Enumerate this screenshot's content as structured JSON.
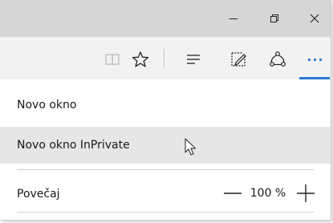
{
  "window": {
    "minimize_icon": "minimize-icon",
    "restore_icon": "restore-icon",
    "close_icon": "close-icon"
  },
  "toolbar": {
    "icons": [
      "reading-view-icon",
      "favorites-star-icon",
      "hub-icon",
      "web-note-icon",
      "share-icon",
      "more-icon"
    ],
    "more_label": "···",
    "accent_color": "#2b79d0"
  },
  "menu": {
    "new_window": "Novo okno",
    "new_inprivate_window": "Novo okno InPrivate",
    "zoom_label": "Povečaj",
    "zoom_value": "100 %"
  }
}
